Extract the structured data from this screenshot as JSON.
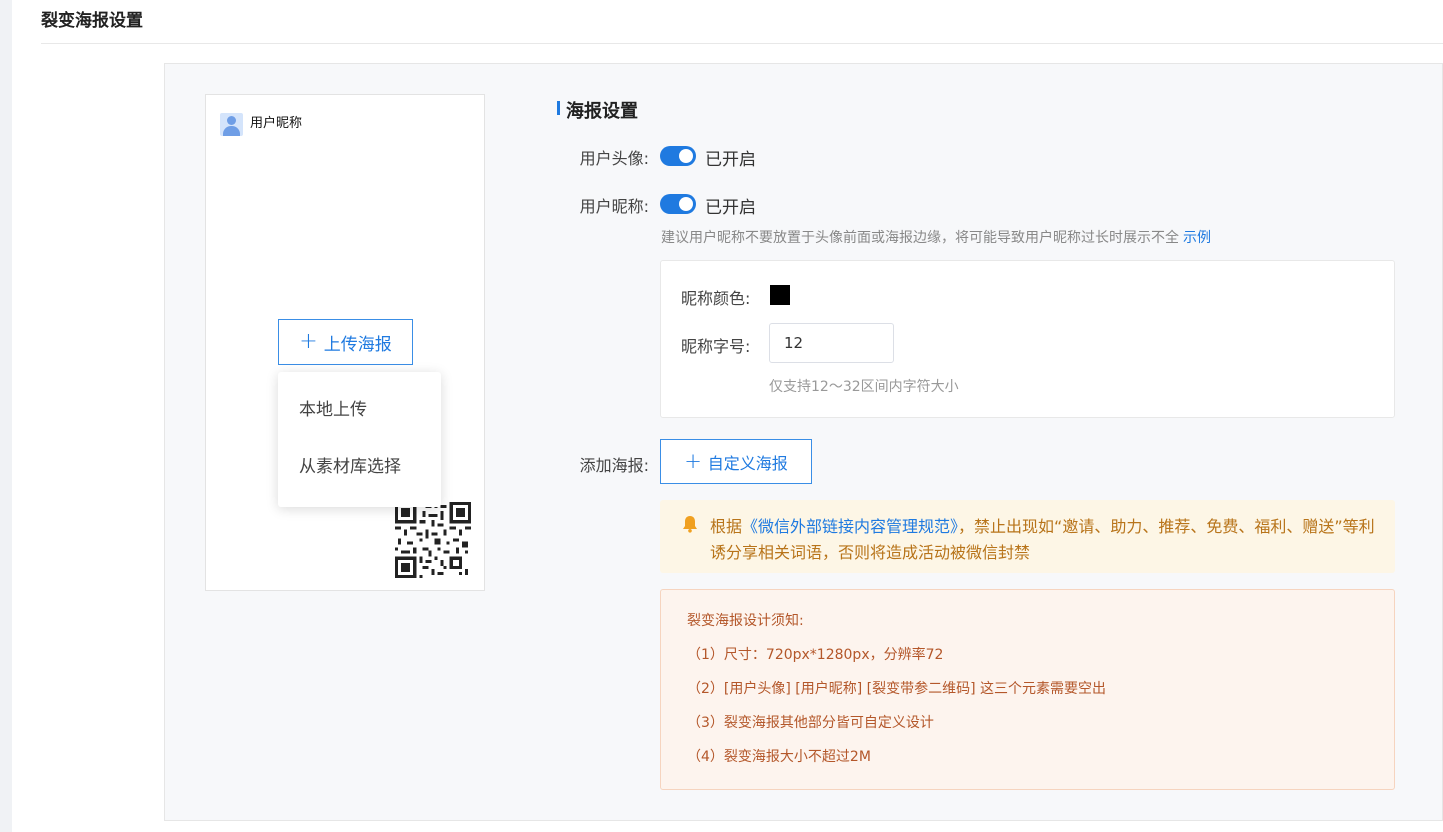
{
  "page": {
    "title": "裂变海报设置"
  },
  "poster": {
    "nickname": "用户昵称",
    "upload_button": "上传海报",
    "menu": [
      "本地上传",
      "从素材库选择"
    ]
  },
  "settings": {
    "section_title": "海报设置",
    "avatar": {
      "label": "用户头像:",
      "status": "已开启",
      "enabled": true
    },
    "nickname": {
      "label": "用户昵称:",
      "status": "已开启",
      "enabled": true
    },
    "hint": "建议用户昵称不要放置于头像前面或海报边缘，将可能导致用户昵称过长时展示不全",
    "hint_link": "示例",
    "color_label": "昵称颜色:",
    "color_value": "#000000",
    "size_label": "昵称字号:",
    "size_value": "12",
    "size_hint": "仅支持12～32区间内字符大小",
    "add_poster_label": "添加海报:",
    "custom_button": "自定义海报"
  },
  "warning": {
    "prefix": "根据",
    "link": "《微信外部链接内容管理规范》",
    "suffix": "，禁止出现如“邀请、助力、推荐、免费、福利、赠送”等利诱分享相关词语，否则将造成活动被微信封禁"
  },
  "notes": [
    "裂变海报设计须知:",
    "（1）尺寸：720px*1280px，分辨率72",
    "（2）[用户头像] [用户昵称] [裂变带参二维码] 这三个元素需要空出",
    "（3）裂变海报其他部分皆可自定义设计",
    "（4）裂变海报大小不超过2M"
  ]
}
